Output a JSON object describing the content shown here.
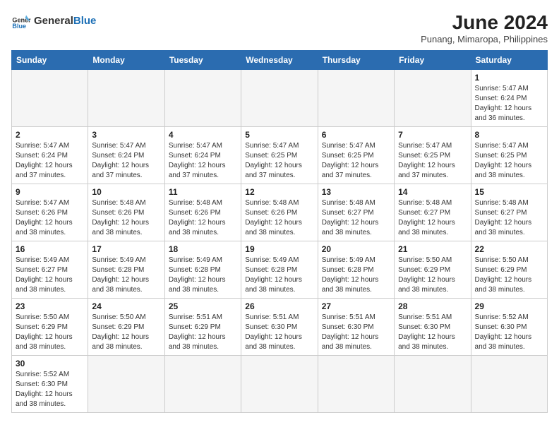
{
  "header": {
    "logo_general": "General",
    "logo_blue": "Blue",
    "month_year": "June 2024",
    "location": "Punang, Mimaropa, Philippines"
  },
  "weekdays": [
    "Sunday",
    "Monday",
    "Tuesday",
    "Wednesday",
    "Thursday",
    "Friday",
    "Saturday"
  ],
  "weeks": [
    [
      {
        "day": "",
        "info": ""
      },
      {
        "day": "",
        "info": ""
      },
      {
        "day": "",
        "info": ""
      },
      {
        "day": "",
        "info": ""
      },
      {
        "day": "",
        "info": ""
      },
      {
        "day": "",
        "info": ""
      },
      {
        "day": "1",
        "info": "Sunrise: 5:47 AM\nSunset: 6:24 PM\nDaylight: 12 hours and 36 minutes."
      }
    ],
    [
      {
        "day": "2",
        "info": "Sunrise: 5:47 AM\nSunset: 6:24 PM\nDaylight: 12 hours and 37 minutes."
      },
      {
        "day": "3",
        "info": "Sunrise: 5:47 AM\nSunset: 6:24 PM\nDaylight: 12 hours and 37 minutes."
      },
      {
        "day": "4",
        "info": "Sunrise: 5:47 AM\nSunset: 6:24 PM\nDaylight: 12 hours and 37 minutes."
      },
      {
        "day": "5",
        "info": "Sunrise: 5:47 AM\nSunset: 6:25 PM\nDaylight: 12 hours and 37 minutes."
      },
      {
        "day": "6",
        "info": "Sunrise: 5:47 AM\nSunset: 6:25 PM\nDaylight: 12 hours and 37 minutes."
      },
      {
        "day": "7",
        "info": "Sunrise: 5:47 AM\nSunset: 6:25 PM\nDaylight: 12 hours and 37 minutes."
      },
      {
        "day": "8",
        "info": "Sunrise: 5:47 AM\nSunset: 6:25 PM\nDaylight: 12 hours and 38 minutes."
      }
    ],
    [
      {
        "day": "9",
        "info": "Sunrise: 5:47 AM\nSunset: 6:26 PM\nDaylight: 12 hours and 38 minutes."
      },
      {
        "day": "10",
        "info": "Sunrise: 5:48 AM\nSunset: 6:26 PM\nDaylight: 12 hours and 38 minutes."
      },
      {
        "day": "11",
        "info": "Sunrise: 5:48 AM\nSunset: 6:26 PM\nDaylight: 12 hours and 38 minutes."
      },
      {
        "day": "12",
        "info": "Sunrise: 5:48 AM\nSunset: 6:26 PM\nDaylight: 12 hours and 38 minutes."
      },
      {
        "day": "13",
        "info": "Sunrise: 5:48 AM\nSunset: 6:27 PM\nDaylight: 12 hours and 38 minutes."
      },
      {
        "day": "14",
        "info": "Sunrise: 5:48 AM\nSunset: 6:27 PM\nDaylight: 12 hours and 38 minutes."
      },
      {
        "day": "15",
        "info": "Sunrise: 5:48 AM\nSunset: 6:27 PM\nDaylight: 12 hours and 38 minutes."
      }
    ],
    [
      {
        "day": "16",
        "info": "Sunrise: 5:49 AM\nSunset: 6:27 PM\nDaylight: 12 hours and 38 minutes."
      },
      {
        "day": "17",
        "info": "Sunrise: 5:49 AM\nSunset: 6:28 PM\nDaylight: 12 hours and 38 minutes."
      },
      {
        "day": "18",
        "info": "Sunrise: 5:49 AM\nSunset: 6:28 PM\nDaylight: 12 hours and 38 minutes."
      },
      {
        "day": "19",
        "info": "Sunrise: 5:49 AM\nSunset: 6:28 PM\nDaylight: 12 hours and 38 minutes."
      },
      {
        "day": "20",
        "info": "Sunrise: 5:49 AM\nSunset: 6:28 PM\nDaylight: 12 hours and 38 minutes."
      },
      {
        "day": "21",
        "info": "Sunrise: 5:50 AM\nSunset: 6:29 PM\nDaylight: 12 hours and 38 minutes."
      },
      {
        "day": "22",
        "info": "Sunrise: 5:50 AM\nSunset: 6:29 PM\nDaylight: 12 hours and 38 minutes."
      }
    ],
    [
      {
        "day": "23",
        "info": "Sunrise: 5:50 AM\nSunset: 6:29 PM\nDaylight: 12 hours and 38 minutes."
      },
      {
        "day": "24",
        "info": "Sunrise: 5:50 AM\nSunset: 6:29 PM\nDaylight: 12 hours and 38 minutes."
      },
      {
        "day": "25",
        "info": "Sunrise: 5:51 AM\nSunset: 6:29 PM\nDaylight: 12 hours and 38 minutes."
      },
      {
        "day": "26",
        "info": "Sunrise: 5:51 AM\nSunset: 6:30 PM\nDaylight: 12 hours and 38 minutes."
      },
      {
        "day": "27",
        "info": "Sunrise: 5:51 AM\nSunset: 6:30 PM\nDaylight: 12 hours and 38 minutes."
      },
      {
        "day": "28",
        "info": "Sunrise: 5:51 AM\nSunset: 6:30 PM\nDaylight: 12 hours and 38 minutes."
      },
      {
        "day": "29",
        "info": "Sunrise: 5:52 AM\nSunset: 6:30 PM\nDaylight: 12 hours and 38 minutes."
      }
    ],
    [
      {
        "day": "30",
        "info": "Sunrise: 5:52 AM\nSunset: 6:30 PM\nDaylight: 12 hours and 38 minutes."
      },
      {
        "day": "",
        "info": ""
      },
      {
        "day": "",
        "info": ""
      },
      {
        "day": "",
        "info": ""
      },
      {
        "day": "",
        "info": ""
      },
      {
        "day": "",
        "info": ""
      },
      {
        "day": "",
        "info": ""
      }
    ]
  ]
}
